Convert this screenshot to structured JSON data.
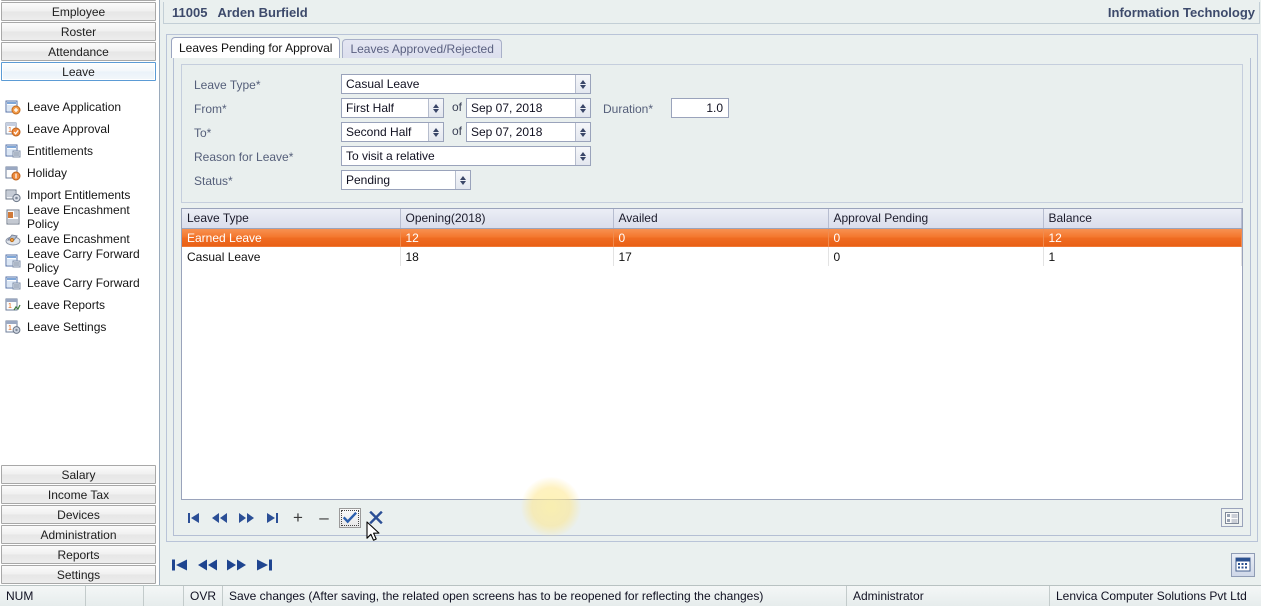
{
  "sidebar": {
    "top_buttons": [
      {
        "label": "",
        "partial": true
      },
      {
        "label": "Employee",
        "selected": false
      },
      {
        "label": "Roster",
        "selected": false
      },
      {
        "label": "Attendance",
        "selected": false
      },
      {
        "label": "Leave",
        "selected": true
      }
    ],
    "tree_items": [
      {
        "label": "Leave Application",
        "icon": "leave-application-icon"
      },
      {
        "label": "Leave Approval",
        "icon": "leave-approval-icon"
      },
      {
        "label": "Entitlements",
        "icon": "entitlements-icon"
      },
      {
        "label": "Holiday",
        "icon": "holiday-icon"
      },
      {
        "label": "Import Entitlements",
        "icon": "import-entitlements-icon"
      },
      {
        "label": "Leave Encashment Policy",
        "icon": "leave-encashment-policy-icon"
      },
      {
        "label": "Leave Encashment",
        "icon": "leave-encashment-icon"
      },
      {
        "label": "Leave Carry Forward Policy",
        "icon": "leave-carry-forward-policy-icon"
      },
      {
        "label": "Leave Carry Forward",
        "icon": "leave-carry-forward-icon"
      },
      {
        "label": "Leave Reports",
        "icon": "leave-reports-icon"
      },
      {
        "label": "Leave Settings",
        "icon": "leave-settings-icon"
      }
    ],
    "bottom_buttons": [
      {
        "label": "Salary"
      },
      {
        "label": "Income Tax"
      },
      {
        "label": "Devices"
      },
      {
        "label": "Administration"
      },
      {
        "label": "Reports"
      },
      {
        "label": "Settings"
      }
    ]
  },
  "header": {
    "employee_id": "11005",
    "employee_name": "Arden Burfield",
    "department": "Information Technology"
  },
  "tabs": [
    {
      "label": "Leaves Pending for Approval",
      "active": true
    },
    {
      "label": "Leaves Approved/Rejected",
      "active": false
    }
  ],
  "form": {
    "leave_type_label": "Leave Type*",
    "leave_type_value": "Casual Leave",
    "from_label": "From*",
    "from_half_value": "First Half",
    "from_of": "of",
    "from_date_value": "Sep 07, 2018",
    "to_label": "To*",
    "to_half_value": "Second Half",
    "to_of": "of",
    "to_date_value": "Sep 07, 2018",
    "duration_label": "Duration*",
    "duration_value": "1.0",
    "reason_label": "Reason for Leave*",
    "reason_value": "To visit a relative",
    "status_label": "Status*",
    "status_value": "Pending"
  },
  "grid": {
    "columns": [
      "Leave Type",
      "Opening(2018)",
      "Availed",
      "Approval Pending",
      "Balance"
    ],
    "rows": [
      {
        "selected": true,
        "cells": [
          "Earned Leave",
          "12",
          "0",
          "0",
          "12"
        ]
      },
      {
        "selected": false,
        "cells": [
          "Casual Leave",
          "18",
          "17",
          "0",
          "1"
        ]
      }
    ]
  },
  "navigator": {
    "first_label": "|◀",
    "prev_label": "◀◀",
    "next_label": "▶▶",
    "last_label": "▶|",
    "add_label": "+",
    "delete_label": "–",
    "ok_label": "✔",
    "cancel_label": "✖",
    "grid_view_label": "grid-view-icon"
  },
  "record_navigator": {
    "first_label": "|◀",
    "prev_label": "◀◀",
    "next_label": "▶▶",
    "last_label": "▶|",
    "calendar_label": "calendar-icon"
  },
  "statusbar": {
    "num": "NUM",
    "blank1": "",
    "blank2": "",
    "ovr": "OVR",
    "message": "Save changes (After saving, the related open screens has to be reopened for reflecting the changes)",
    "user": "Administrator",
    "company": "Lenvica Computer Solutions Pvt Ltd"
  },
  "colors": {
    "selection_orange": "#ef6b21",
    "accent_blue": "#2b4f96",
    "panel_bg": "#eaf0ef",
    "header_text": "#3d4a6b"
  }
}
